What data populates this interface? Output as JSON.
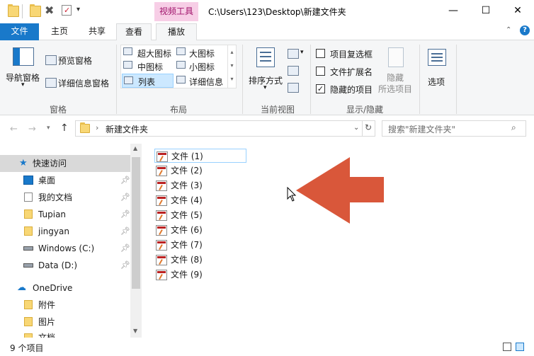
{
  "titlebar": {
    "context_tab": "视频工具",
    "path": "C:\\Users\\123\\Desktop\\新建文件夹",
    "minimize": "—",
    "maximize": "☐",
    "close": "✕"
  },
  "tabs": {
    "file": "文件",
    "home": "主页",
    "share": "共享",
    "view": "查看",
    "play": "播放"
  },
  "ribbon": {
    "pane": {
      "nav_pane": "导航窗格",
      "preview_pane": "预览窗格",
      "details_pane": "详细信息窗格",
      "group_label": "窗格"
    },
    "layout": {
      "xl_icons": "超大图标",
      "large_icons": "大图标",
      "medium_icons": "中图标",
      "small_icons": "小图标",
      "list": "列表",
      "details": "详细信息",
      "group_label": "布局"
    },
    "current_view": {
      "sort_by": "排序方式",
      "group_label": "当前视图"
    },
    "show_hide": {
      "item_checkboxes": "项目复选框",
      "file_extensions": "文件扩展名",
      "hidden_items": "隐藏的项目",
      "hide_selected": "隐藏",
      "hide_selected_2": "所选项目",
      "group_label": "显示/隐藏"
    },
    "options": "选项"
  },
  "address": {
    "current": "新建文件夹",
    "search_placeholder": "搜索\"新建文件夹\""
  },
  "nav": {
    "quick_access": "快速访问",
    "items": [
      "桌面",
      "我的文档",
      "Tupian",
      "jingyan",
      "Windows (C:)",
      "Data (D:)"
    ],
    "onedrive": "OneDrive",
    "onedrive_items": [
      "附件",
      "图片",
      "文档"
    ]
  },
  "files": [
    "文件 (1)",
    "文件 (2)",
    "文件 (3)",
    "文件 (4)",
    "文件 (5)",
    "文件 (6)",
    "文件 (7)",
    "文件 (8)",
    "文件 (9)"
  ],
  "status": {
    "count": "9 个项目"
  },
  "colors": {
    "accent": "#1979ca",
    "context_tab_bg": "#f7cee6",
    "arrow": "#d9573a",
    "ribbon_bg": "#f5f6f7",
    "selection": "#cce8ff"
  }
}
